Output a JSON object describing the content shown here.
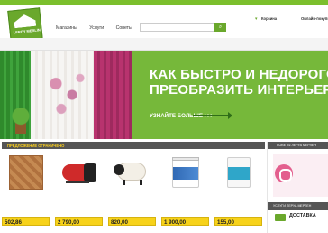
{
  "top_strip": {
    "links": [
      "",
      ""
    ]
  },
  "logo": {
    "brand": "LEROY MERLIN",
    "slogan": ""
  },
  "header": {
    "city_line": [
      "",
      ""
    ],
    "nav": [
      "Магазины",
      "Услуги",
      "Советы"
    ],
    "search_placeholder": "",
    "cart_title": "Корзина",
    "cart_sub": "",
    "sales_title": "Онлайн-покупки",
    "sales_sub": ""
  },
  "categories": [
    "",
    "",
    "",
    "",
    "",
    "",
    "",
    "",
    "",
    "",
    "",
    "",
    "",
    "",
    "",
    ""
  ],
  "hero": {
    "title_line1": "КАК БЫСТРО И НЕДОРОГО",
    "title_line2": "ПРЕОБРАЗИТЬ ИНТЕРЬЕР?",
    "more": "УЗНАЙТЕ БОЛЬШЕ"
  },
  "promo": {
    "label": "ПРЕДЛОЖЕНИЕ ОГРАНИЧЕНО"
  },
  "products": [
    {
      "name": "",
      "price": "502,86",
      "unit": ""
    },
    {
      "name": "",
      "price": "2 790,00",
      "unit": ""
    },
    {
      "name": "",
      "price": "820,00",
      "unit": ""
    },
    {
      "name": "",
      "price": "1 900,00",
      "unit": ""
    },
    {
      "name": "",
      "price": "155,00",
      "unit": ""
    }
  ],
  "sidebar": {
    "advice_title": "СОВЕТЫ ЛЕРУА МЕРЛЕН",
    "advice_tip": "",
    "services_title": "УСЛУГИ ЛЕРУА МЕРЛЕН",
    "delivery": "ДОСТАВКА",
    "delivery_sub": ""
  },
  "colors": {
    "brand_green": "#6aa82c",
    "hero_green": "#76b83a",
    "price_yellow": "#f7d21a",
    "promo_yellow": "#ffd21a"
  }
}
